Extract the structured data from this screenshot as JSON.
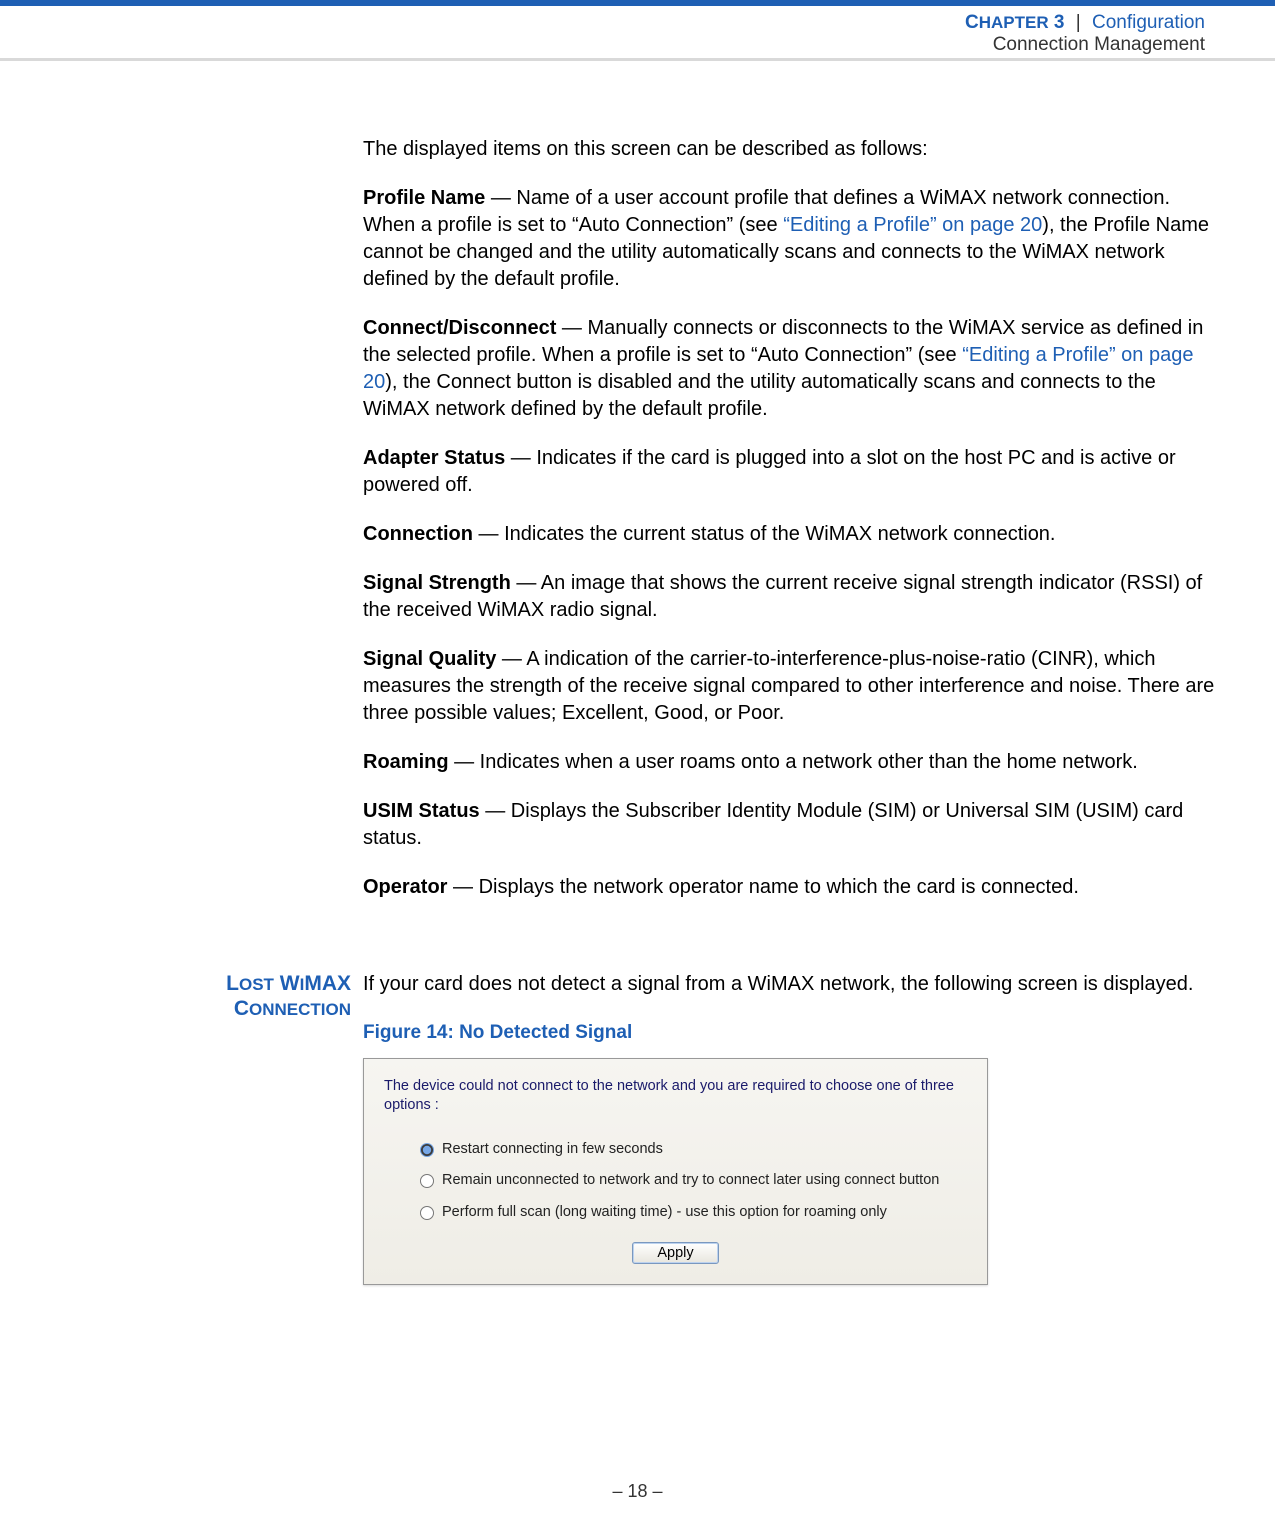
{
  "header": {
    "chapter_prefix": "C",
    "chapter_rest": "HAPTER",
    "chapter_num": " 3",
    "pipe": "|",
    "section": "Configuration",
    "subsection": "Connection Management"
  },
  "intro": "The displayed items on this screen can be described as follows:",
  "items": {
    "profile_name": {
      "term": "Profile Name",
      "text1": " — Name of a user account profile that defines a WiMAX network connection. When a profile is set to “Auto Connection” (see ",
      "link": "“Editing a Profile” on page 20",
      "text2": "), the Profile Name cannot be changed and the utility automatically scans and connects to the WiMAX network defined by the default profile."
    },
    "connect": {
      "term": "Connect/Disconnect",
      "text1": " — Manually connects or disconnects to the WiMAX service as defined in the selected profile. When a profile is set to “Auto Connection” (see ",
      "link": "“Editing a Profile” on page 20",
      "text2": "), the Connect button is disabled and the utility automatically scans and connects to the WiMAX network defined by the default profile."
    },
    "adapter": {
      "term": "Adapter Status",
      "text": " — Indicates if the card is plugged into a slot on the host PC and is active or powered off."
    },
    "connection": {
      "term": "Connection",
      "text": " — Indicates the current status of the WiMAX network connection."
    },
    "signal_strength": {
      "term": "Signal Strength",
      "text": " — An image that shows the current receive signal strength indicator (RSSI) of the received WiMAX radio signal."
    },
    "signal_quality": {
      "term": "Signal Quality",
      "text": " — A indication of the carrier-to-interference-plus-noise-ratio (CINR), which measures the strength of the receive signal compared to other interference and noise. There are three possible values; Excellent, Good, or Poor."
    },
    "roaming": {
      "term": "Roaming",
      "text": " — Indicates when a user roams onto a network other than the home network."
    },
    "usim": {
      "term": "USIM Status",
      "text": " — Displays the Subscriber Identity Module (SIM) or Universal SIM (USIM) card status."
    },
    "operator": {
      "term": "Operator",
      "text": " — Displays the network operator name to which the card is connected."
    }
  },
  "lost_section": {
    "heading_l1_a": "L",
    "heading_l1_b": "OST",
    "heading_l1_c": " W",
    "heading_l1_d": "I",
    "heading_l1_e": "MAX",
    "heading_l2_a": "C",
    "heading_l2_b": "ONNECTION",
    "body": "If your card does not detect a signal from a WiMAX network, the following screen is displayed.",
    "figure_caption": "Figure 14:  No Detected Signal"
  },
  "dialog": {
    "message": "The device could not connect to the network and you are required to choose one of three options :",
    "opt1": "Restart connecting in few seconds",
    "opt2": "Remain unconnected to network and try to connect later using connect button",
    "opt3": "Perform full scan (long waiting time) - use this option for roaming only",
    "apply": "Apply"
  },
  "footer": "–  18  –"
}
